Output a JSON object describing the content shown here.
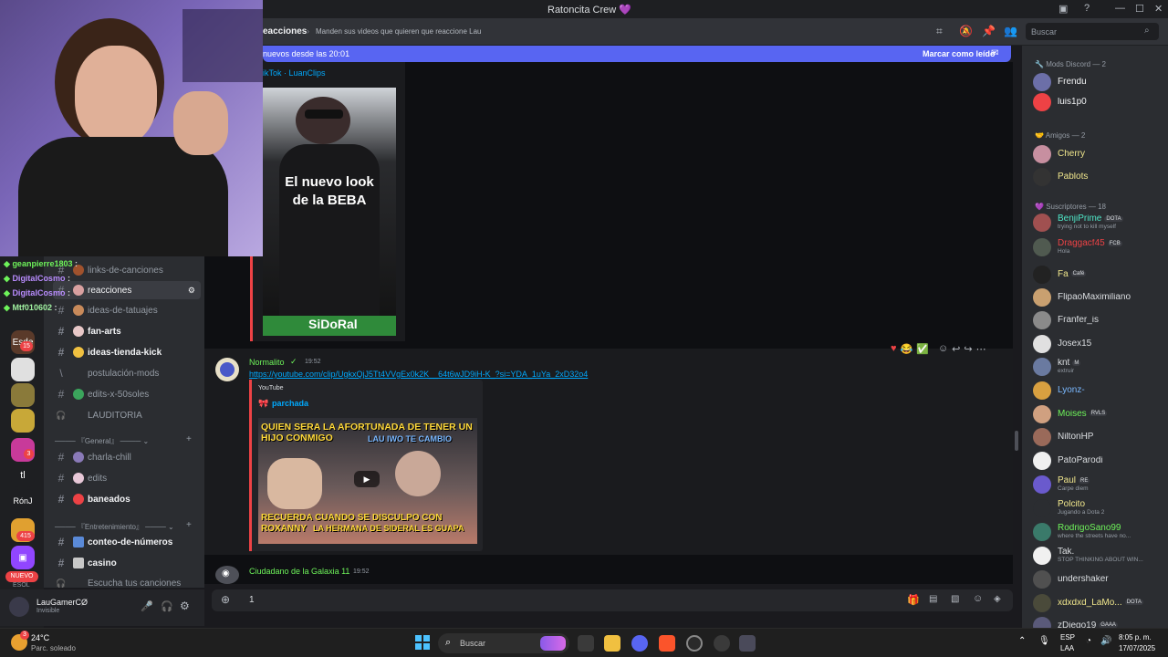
{
  "window": {
    "title": "Ratoncita Crew 💜",
    "controls": {
      "minimize": "—",
      "maximize": "☐",
      "close": "✕"
    }
  },
  "header": {
    "channel": "eacciones",
    "topic": "Manden sus videos que quieren que reaccione Lau",
    "search_placeholder": "Buscar"
  },
  "banner": {
    "text": "nuevos desde las 20:01",
    "action": "Marcar como leído"
  },
  "twitch_chat": [
    {
      "name": "geanpierre1803",
      "color": "#6ef35a"
    },
    {
      "name": "DigitalCosmo",
      "color": "#b98cff"
    },
    {
      "name": "DigitalCosmo",
      "color": "#b98cff"
    },
    {
      "name": "Mtf010602",
      "color": "#a0f0a0"
    }
  ],
  "servers": [
    {
      "label": "Esde",
      "badge": "15"
    },
    {
      "label": ""
    },
    {
      "label": ""
    },
    {
      "label": ""
    },
    {
      "label": "",
      "badge": "3"
    },
    {
      "label": "tl"
    },
    {
      "label": "RónJ"
    },
    {
      "label": "",
      "badge": "415"
    },
    {
      "label": ""
    },
    {
      "label": "NUEVO"
    },
    {
      "label": "ESOL"
    }
  ],
  "channels": {
    "items": [
      {
        "icon": "#",
        "name": "links-de-canciones",
        "bold": false
      },
      {
        "icon": "#",
        "name": "reacciones",
        "bold": false,
        "active": true
      },
      {
        "icon": "#",
        "name": "ideas-de-tatuajes",
        "bold": false
      },
      {
        "icon": "#",
        "name": "fan-arts",
        "bold": true
      },
      {
        "icon": "#",
        "name": "ideas-tienda-kick",
        "bold": true
      },
      {
        "icon": "\\",
        "name": "postulación-mods",
        "bold": false
      },
      {
        "icon": "#",
        "name": "edits-x-50soles",
        "bold": false
      },
      {
        "icon": "🎧",
        "name": "LAUDITORIA",
        "bold": false
      }
    ],
    "category_general": "『General』",
    "general_items": [
      {
        "icon": "#",
        "name": "charla-chill",
        "bold": false
      },
      {
        "icon": "#",
        "name": "edits",
        "bold": false
      },
      {
        "icon": "#",
        "name": "baneados",
        "bold": true
      }
    ],
    "category_entretenimiento": "『Entretenimiento』",
    "ent_items": [
      {
        "icon": "#",
        "name": "conteo-de-números",
        "bold": true
      },
      {
        "icon": "#",
        "name": "casino",
        "bold": true
      },
      {
        "icon": "🎧",
        "name": "Escucha tus canciones",
        "bold": false
      }
    ]
  },
  "user": {
    "name": "LauGamerCØ",
    "status": "Invisible"
  },
  "messages": {
    "embed1": {
      "source": "ikTok · LuanClips",
      "thumb_text": "El nuevo look de la BEBA",
      "thumb_footer": "SiDoRal"
    },
    "msg2": {
      "author": "Normalito",
      "time": "19:52",
      "link": "https://youtube.com/clip/UgkxQjJ5Tt4VVgEx0k2K__64t6wJD9iH-K_?si=YDA_1uYa_2xD32o4",
      "embed_provider": "YouTube",
      "embed_author": "parchada",
      "thumb_top": "QUIEN SERA LA AFORTUNADA DE TENER UN HIJO CONMIGO",
      "thumb_mid": "LAU IWO TE CAMBIO",
      "thumb_bottom": "RECUERDA CUANDO SE DISCULPO CON ROXANNY",
      "thumb_bottom2": "LA HERMANA DE SIDERAL ES GUAPA"
    },
    "msg3": {
      "author": "Ciudadano de la Galaxia 11",
      "time": "19:52"
    }
  },
  "input": {
    "value": "1"
  },
  "members": {
    "categories": [
      "Mods Discord — 2",
      "Amigos — 2",
      "Suscriptores — 18"
    ],
    "mods": [
      {
        "name": "Frendu",
        "status": "",
        "color": "#f2f3f5",
        "av": "#6c6fa8"
      },
      {
        "name": "luis1p0",
        "status": "",
        "color": "#f2f3f5",
        "av": "#ed4245"
      }
    ],
    "friends": [
      {
        "name": "Cherry",
        "status": "",
        "color": "#f0e68c",
        "av": "#c78fa0"
      },
      {
        "name": "Pablots",
        "status": "",
        "color": "#f0e68c",
        "av": "#333333"
      }
    ],
    "subs": [
      {
        "name": "BenjiPrime",
        "status": "trying not to kill myself",
        "color": "#4fe8c8",
        "av": "#a05050",
        "tag": "DOTA"
      },
      {
        "name": "Draggacf45",
        "status": "Hola",
        "color": "#ed4245",
        "av": "#505a50",
        "tag": "FCB"
      },
      {
        "name": "Fa",
        "status": "",
        "color": "#f0e68c",
        "av": "#222222",
        "tag": "Café"
      },
      {
        "name": "FlipaoMaximiliano",
        "status": "",
        "color": "#dbdee1",
        "av": "#c9a070"
      },
      {
        "name": "Franfer_is",
        "status": "",
        "color": "#dbdee1",
        "av": "#8a8a8a"
      },
      {
        "name": "Josex15",
        "status": "",
        "color": "#dbdee1",
        "av": "#e0e0e0"
      },
      {
        "name": "knt",
        "status": "extruir",
        "color": "#dbdee1",
        "av": "#6a7aa0",
        "tag": "M"
      },
      {
        "name": "Lyonz-",
        "status": "",
        "color": "#7ab8ff",
        "av": "#d8a040"
      },
      {
        "name": "Moises",
        "status": "",
        "color": "#6ef35a",
        "av": "#d0a080",
        "tag": "RVLS"
      },
      {
        "name": "NiltonHP",
        "status": "",
        "color": "#dbdee1",
        "av": "#9a6a5a"
      },
      {
        "name": "PatoParodi",
        "status": "",
        "color": "#dbdee1",
        "av": "#f0f0f0"
      },
      {
        "name": "Paul",
        "status": "Carpe diem",
        "color": "#f0e68c",
        "av": "#6a5acd",
        "tag": "RE"
      },
      {
        "name": "Polcito",
        "status": "Jugando a Dota 2",
        "color": "#f0e68c",
        "av": "#2b2d31"
      },
      {
        "name": "RodrigoSano99",
        "status": "where the streets have no...",
        "color": "#6ef35a",
        "av": "#3a7a6a"
      },
      {
        "name": "Tak.",
        "status": "STOP THINKING ABOUT WIN...",
        "color": "#dbdee1",
        "av": "#f0f0f0"
      },
      {
        "name": "undershaker",
        "status": "",
        "color": "#dbdee1",
        "av": "#505050"
      },
      {
        "name": "xdxdxd_LaMo...",
        "status": "",
        "color": "#f0e68c",
        "av": "#4a4a3a",
        "tag": "DOTA"
      },
      {
        "name": "zDiego19",
        "status": "",
        "color": "#dbdee1",
        "av": "#5a5a7a",
        "tag": "GAAA"
      }
    ]
  },
  "taskbar": {
    "weather_temp": "24°C",
    "weather_desc": "Parc. soleado",
    "search": "Buscar",
    "lang": "ESP",
    "lang2": "LAA",
    "time": "8:05 p. m.",
    "date": "17/07/2025",
    "badge": "3"
  }
}
